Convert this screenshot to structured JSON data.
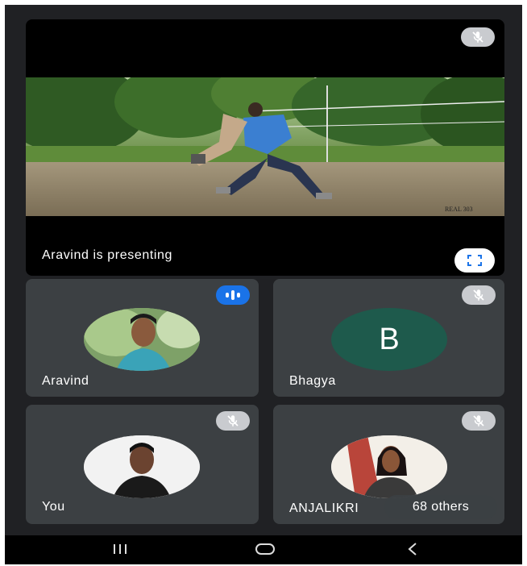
{
  "presenter": {
    "label": "Aravind is presenting",
    "watermark": "REAL 303"
  },
  "tiles": [
    {
      "name": "Aravind",
      "status": "speaking"
    },
    {
      "name": "Bhagya",
      "initial": "B",
      "avatar_color": "#1e5a4c",
      "status": "muted"
    },
    {
      "name": "You",
      "status": "muted"
    },
    {
      "name": "ANJALIKRI",
      "status": "muted",
      "others_label": "68 others"
    }
  ],
  "icons": {
    "mute": "mic-off-icon",
    "speaking": "audio-level-icon",
    "fullscreen": "fullscreen-icon",
    "nav_recent": "recent-apps-icon",
    "nav_home": "home-icon",
    "nav_back": "back-icon"
  },
  "colors": {
    "background": "#202124",
    "tile": "#3c4043",
    "accent": "#1a73e8"
  }
}
